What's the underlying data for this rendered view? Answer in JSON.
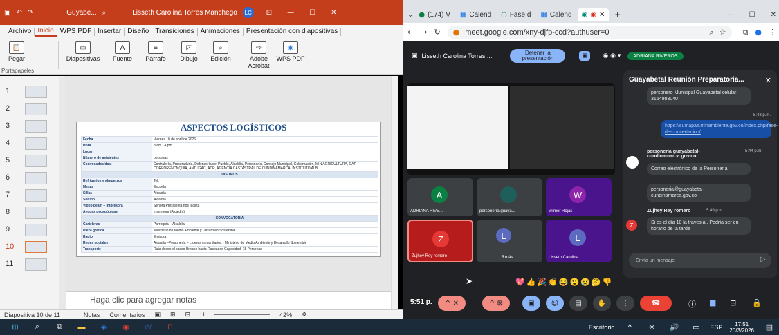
{
  "ppt": {
    "title_short": "Guyabe...",
    "user_name": "Lisseth Carolina Torres Manchego",
    "user_initials": "LC",
    "menu": [
      "Archivo",
      "Inicio",
      "WPS PDF",
      "Insertar",
      "Diseño",
      "Transiciones",
      "Animaciones",
      "Presentación con diapositivas"
    ],
    "ribbon": {
      "pegar": "Pegar",
      "diapositivas": "Diapositivas",
      "fuente": "Fuente",
      "parrafo": "Párrafo",
      "dibujo": "Dibujo",
      "edicion": "Edición",
      "adobe": "Adobe Acrobat",
      "wps": "WPS PDF",
      "portapapeles": "Portapapeles"
    },
    "slide_numbers": [
      "1",
      "2",
      "3",
      "4",
      "5",
      "6",
      "7",
      "8",
      "9",
      "10",
      "11"
    ],
    "slide_title": "ASPECTOS LOGÍSTICOS",
    "rows": [
      {
        "k": "Fecha",
        "v": "Viernes 10 de abril de 2026"
      },
      {
        "k": "Hora",
        "v": "8 am - 4 pm"
      },
      {
        "k": "Lugar",
        "v": ""
      },
      {
        "k": "Número de asistentes",
        "v": "personas"
      },
      {
        "k": "Convocados/das:",
        "v": "Contraloría, Procuraduría, Defensoría del Pueblo, Alcaldía, Personería, Concejo Municipal, Gobernación, MIN AGRICULTURA, CAR - CORPORENONQUIA, ANT, IGAC, ADR, AGENCIA CASTASTRAL DE CUNDINAMARCA, INSTITUTO ALB"
      },
      {
        "sec": "INSUMOS"
      },
      {
        "k": "Refrigerios y almuerzos",
        "v": "Tel."
      },
      {
        "k": "Mesas",
        "v": "Escuela"
      },
      {
        "k": "Sillas",
        "v": "Alcaldía"
      },
      {
        "k": "Sonido",
        "v": "Alcaldía"
      },
      {
        "k": "Video beam – impresora",
        "v": "Señora Presidenta nos facilita"
      },
      {
        "k": "Ayudas pedagógicas",
        "v": "Impresora (Alcaldía)"
      },
      {
        "sec": "CONVOCATORIA"
      },
      {
        "k": "Carteleras",
        "v": "Parroquia – Alcaldía"
      },
      {
        "k": "Pieza gráfica",
        "v": "Ministerio de Medio Ambiente y Desarrollo Sostenible"
      },
      {
        "k": "Radio",
        "v": "Emisora"
      },
      {
        "k": "Redes sociales",
        "v": "Alcaldía –Personería – Líderes comunitarios - Ministerio de Medio Ambiente y Desarrollo Sostenible"
      },
      {
        "k": "Transporte",
        "v": "Ruta desde el casco Urbano hasta Raspados Capacidad: 15 Personas"
      }
    ],
    "notes_placeholder": "Haga clic para agregar notas",
    "status": {
      "slide": "Diapositiva 10 de 11",
      "notas": "Notas",
      "comentarios": "Comentarios",
      "zoom": "42%"
    }
  },
  "browser": {
    "tabs": [
      "(174) V",
      "Calend",
      "Fase d",
      "Calend"
    ],
    "url": "meet.google.com/xny-djfp-ccd?authuser=0"
  },
  "meet": {
    "presenter": "Lisseth Carolina Torres ...",
    "stop_label": "Detener la presentación",
    "tag_name": "ADRIANA RIVEROS",
    "tiles": [
      {
        "letter": "A",
        "name": "ADRIANA RIVE...",
        "color": "#0b8043"
      },
      {
        "letter": "",
        "name": "personería guaya...",
        "color": "#1f5f5b"
      },
      {
        "letter": "W",
        "name": "wilmer Rojas",
        "color": "#8e24aa"
      },
      {
        "letter": "Z",
        "name": "Zujhey Rey romero",
        "color": "#e53935"
      },
      {
        "letter": "L",
        "name": "5 más",
        "color": "#5c6bc0"
      },
      {
        "letter": "L",
        "name": "Lisseth Carolina ...",
        "color": "#5c6bc0"
      }
    ],
    "chat_title": "Guayabetal Reunión Preparatoria...",
    "msgs": {
      "m1": "personero Municipal Guayabetal celular 3164983040",
      "t1": "5:43 p.m.",
      "m2": "https://sumapaz.minambiente.gov.co/index.php/fase-de-concertacion/",
      "s3": "personeria guayabetal-cundinamarca.gov.co",
      "t3": "5:44 p.m.",
      "m3": "Correo electrónico de la Personería",
      "m4": "personeria@guayabetal-cundinamarca.gov.co",
      "s5": "Zujhey Rey romero",
      "t5": "5:49 p.m.",
      "m5": "Si es el día 10 la travesía . Podría ser en horario de la tarde"
    },
    "input_placeholder": "Envía un mensaje",
    "time": "5:51 p.",
    "reactions": "💖👍🎉👏😂😮😢🤔👎"
  },
  "taskbar": {
    "escritorio": "Escritorio",
    "lang": "ESP",
    "time": "17:51",
    "date": "20/3/2026"
  }
}
